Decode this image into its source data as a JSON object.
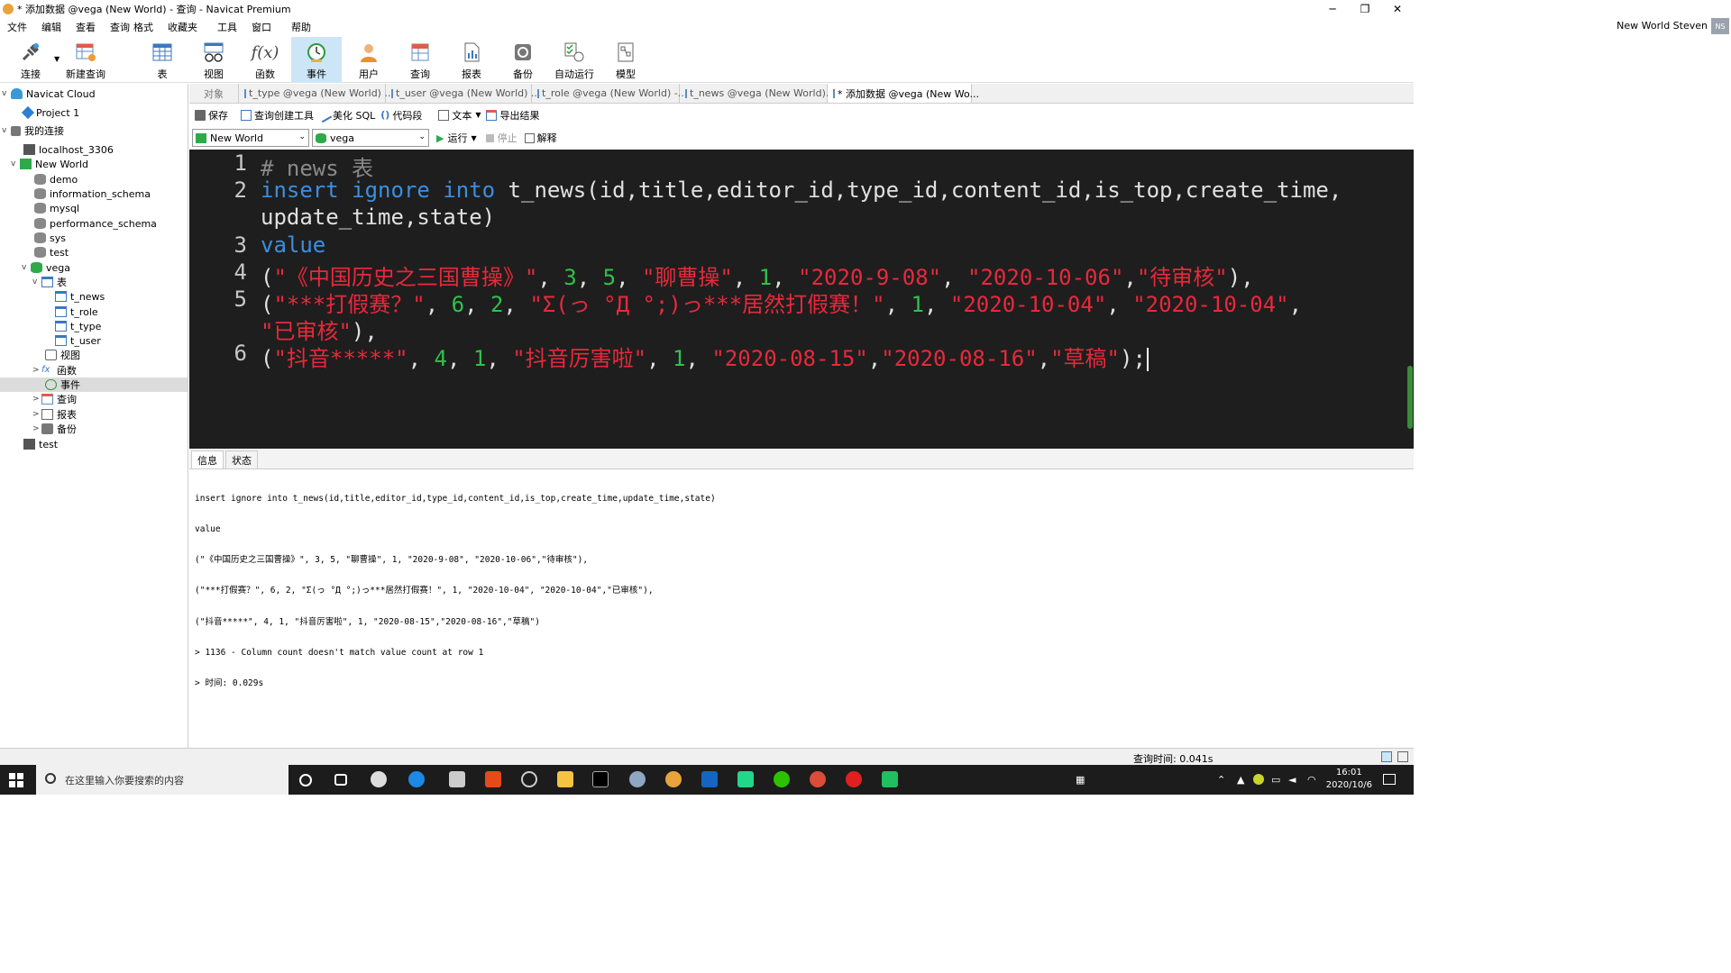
{
  "window": {
    "title": "* 添加数据 @vega (New World) - 查询 - Navicat Premium",
    "controls": {
      "minimize": "─",
      "maximize": "❐",
      "close": "✕"
    }
  },
  "menu": [
    "文件",
    "编辑",
    "查看",
    "查询",
    "格式",
    "收藏夹",
    "工具",
    "窗口",
    "帮助"
  ],
  "user": {
    "name": "New World Steven",
    "initials": "NS"
  },
  "toolbar": [
    {
      "label": "连接",
      "icon": "connect-icon"
    },
    {
      "label": "新建查询",
      "icon": "new-query-icon"
    },
    {
      "label": "表",
      "icon": "table-icon"
    },
    {
      "label": "视图",
      "icon": "view-icon"
    },
    {
      "label": "函数",
      "icon": "function-icon"
    },
    {
      "label": "事件",
      "icon": "event-icon",
      "active": true
    },
    {
      "label": "用户",
      "icon": "user-icon"
    },
    {
      "label": "查询",
      "icon": "query-icon"
    },
    {
      "label": "报表",
      "icon": "report-icon"
    },
    {
      "label": "备份",
      "icon": "backup-icon"
    },
    {
      "label": "自动运行",
      "icon": "automation-icon"
    },
    {
      "label": "模型",
      "icon": "model-icon"
    }
  ],
  "tree": [
    {
      "label": "Navicat Cloud",
      "level": 0,
      "arrow": "v",
      "icon": "cloud-icon"
    },
    {
      "label": "Project 1",
      "level": 1,
      "icon": "project-icon"
    },
    {
      "label": "我的连接",
      "level": 0,
      "arrow": "v",
      "icon": "connection-group-icon"
    },
    {
      "label": "localhost_3306",
      "level": 1,
      "icon": "mysql-connection-icon"
    },
    {
      "label": "New World",
      "level": 1,
      "arrow": "v",
      "icon": "mysql-connection-open-icon"
    },
    {
      "label": "demo",
      "level": 2,
      "icon": "database-icon"
    },
    {
      "label": "information_schema",
      "level": 2,
      "icon": "database-icon"
    },
    {
      "label": "mysql",
      "level": 2,
      "icon": "database-icon"
    },
    {
      "label": "performance_schema",
      "level": 2,
      "icon": "database-icon"
    },
    {
      "label": "sys",
      "level": 2,
      "icon": "database-icon"
    },
    {
      "label": "test",
      "level": 2,
      "icon": "database-icon"
    },
    {
      "label": "vega",
      "level": 2,
      "arrow": "v",
      "icon": "database-open-icon"
    },
    {
      "label": "表",
      "level": 3,
      "arrow": "v",
      "icon": "tables-folder-icon"
    },
    {
      "label": "t_news",
      "level": 4,
      "icon": "table-icon"
    },
    {
      "label": "t_role",
      "level": 4,
      "icon": "table-icon"
    },
    {
      "label": "t_type",
      "level": 4,
      "icon": "table-icon"
    },
    {
      "label": "t_user",
      "level": 4,
      "icon": "table-icon"
    },
    {
      "label": "视图",
      "level": 3,
      "icon": "views-folder-icon"
    },
    {
      "label": "函数",
      "level": 3,
      "arrow": ">",
      "icon": "functions-folder-icon"
    },
    {
      "label": "事件",
      "level": 3,
      "icon": "events-folder-icon",
      "selected": true
    },
    {
      "label": "查询",
      "level": 3,
      "arrow": ">",
      "icon": "queries-folder-icon"
    },
    {
      "label": "报表",
      "level": 3,
      "arrow": ">",
      "icon": "reports-folder-icon"
    },
    {
      "label": "备份",
      "level": 3,
      "arrow": ">",
      "icon": "backups-folder-icon"
    },
    {
      "label": "test",
      "level": 0,
      "icon": "mysql-connection-icon"
    }
  ],
  "tabs": [
    {
      "label": "对象"
    },
    {
      "label": "t_type @vega (New World) ..."
    },
    {
      "label": "t_user @vega (New World) ..."
    },
    {
      "label": "t_role @vega (New World) -..."
    },
    {
      "label": "t_news @vega (New World)..."
    },
    {
      "label": "* 添加数据 @vega (New Wo...",
      "active": true
    }
  ],
  "query_toolbar": {
    "save": "保存",
    "builder": "查询创建工具",
    "beautify": "美化 SQL",
    "snippet": "代码段",
    "text": "文本",
    "export": "导出结果",
    "run": "运行",
    "stop": "停止",
    "explain": "解释"
  },
  "selectors": {
    "connection": "New World",
    "database": "vega"
  },
  "editor": {
    "line_numbers": [
      "1",
      "2",
      "",
      "3",
      "4",
      "5",
      "",
      "6"
    ],
    "lines": [
      [
        {
          "t": "# news 表",
          "c": "cm"
        }
      ],
      [
        {
          "t": "insert",
          "c": "kw"
        },
        {
          "t": " "
        },
        {
          "t": "ignore",
          "c": "kw"
        },
        {
          "t": " "
        },
        {
          "t": "into",
          "c": "kw"
        },
        {
          "t": " t_news(id,title,editor_id,type_id,content_id,is_top,create_time,"
        }
      ],
      [
        {
          "t": "update_time,state)"
        }
      ],
      [
        {
          "t": "value",
          "c": "kw"
        }
      ],
      [
        {
          "t": "("
        },
        {
          "t": "\"《中国历史之三国曹操》\"",
          "c": "st"
        },
        {
          "t": ", "
        },
        {
          "t": "3",
          "c": "nm"
        },
        {
          "t": ", "
        },
        {
          "t": "5",
          "c": "nm"
        },
        {
          "t": ", "
        },
        {
          "t": "\"聊曹操\"",
          "c": "st"
        },
        {
          "t": ", "
        },
        {
          "t": "1",
          "c": "nm"
        },
        {
          "t": ", "
        },
        {
          "t": "\"2020-9-08\"",
          "c": "st"
        },
        {
          "t": ", "
        },
        {
          "t": "\"2020-10-06\"",
          "c": "st"
        },
        {
          "t": ","
        },
        {
          "t": "\"待审核\"",
          "c": "st"
        },
        {
          "t": "),"
        }
      ],
      [
        {
          "t": "("
        },
        {
          "t": "\"***打假赛？\"",
          "c": "st"
        },
        {
          "t": ", "
        },
        {
          "t": "6",
          "c": "nm"
        },
        {
          "t": ", "
        },
        {
          "t": "2",
          "c": "nm"
        },
        {
          "t": ", "
        },
        {
          "t": "\"Σ(っ °Д °;)っ***居然打假赛！\"",
          "c": "st"
        },
        {
          "t": ", "
        },
        {
          "t": "1",
          "c": "nm"
        },
        {
          "t": ", "
        },
        {
          "t": "\"2020-10-04\"",
          "c": "st"
        },
        {
          "t": ", "
        },
        {
          "t": "\"2020-10-04\"",
          "c": "st"
        },
        {
          "t": ","
        }
      ],
      [
        {
          "t": "\"已审核\"",
          "c": "st"
        },
        {
          "t": "),"
        }
      ],
      [
        {
          "t": "("
        },
        {
          "t": "\"抖音*****\"",
          "c": "st"
        },
        {
          "t": ", "
        },
        {
          "t": "4",
          "c": "nm"
        },
        {
          "t": ", "
        },
        {
          "t": "1",
          "c": "nm"
        },
        {
          "t": ", "
        },
        {
          "t": "\"抖音厉害啦\"",
          "c": "st"
        },
        {
          "t": ", "
        },
        {
          "t": "1",
          "c": "nm"
        },
        {
          "t": ", "
        },
        {
          "t": "\"2020-08-15\"",
          "c": "st"
        },
        {
          "t": ","
        },
        {
          "t": "\"2020-08-16\"",
          "c": "st"
        },
        {
          "t": ","
        },
        {
          "t": "\"草稿\"",
          "c": "st"
        },
        {
          "t": ");"
        }
      ]
    ]
  },
  "result_panel": {
    "tabs": [
      "信息",
      "状态"
    ],
    "messages": [
      "insert ignore into t_news(id,title,editor_id,type_id,content_id,is_top,create_time,update_time,state)",
      "value",
      "(\"《中国历史之三国曹操》\", 3, 5, \"聊曹操\", 1, \"2020-9-08\", \"2020-10-06\",\"待审核\"),",
      "(\"***打假赛？\", 6, 2, \"Σ(っ °Д °;)っ***居然打假赛！\", 1, \"2020-10-04\", \"2020-10-04\",\"已审核\"),",
      "(\"抖音*****\", 4, 1, \"抖音厉害啦\", 1, \"2020-08-15\",\"2020-08-16\",\"草稿\")",
      "> 1136 - Column count doesn't match value count at row 1",
      "> 时间: 0.029s"
    ]
  },
  "status": {
    "query_time": "查询时间: 0.041s"
  },
  "taskbar": {
    "search_placeholder": "在这里输入你要搜索的内容",
    "time": "16:01",
    "date": "2020/10/6"
  }
}
